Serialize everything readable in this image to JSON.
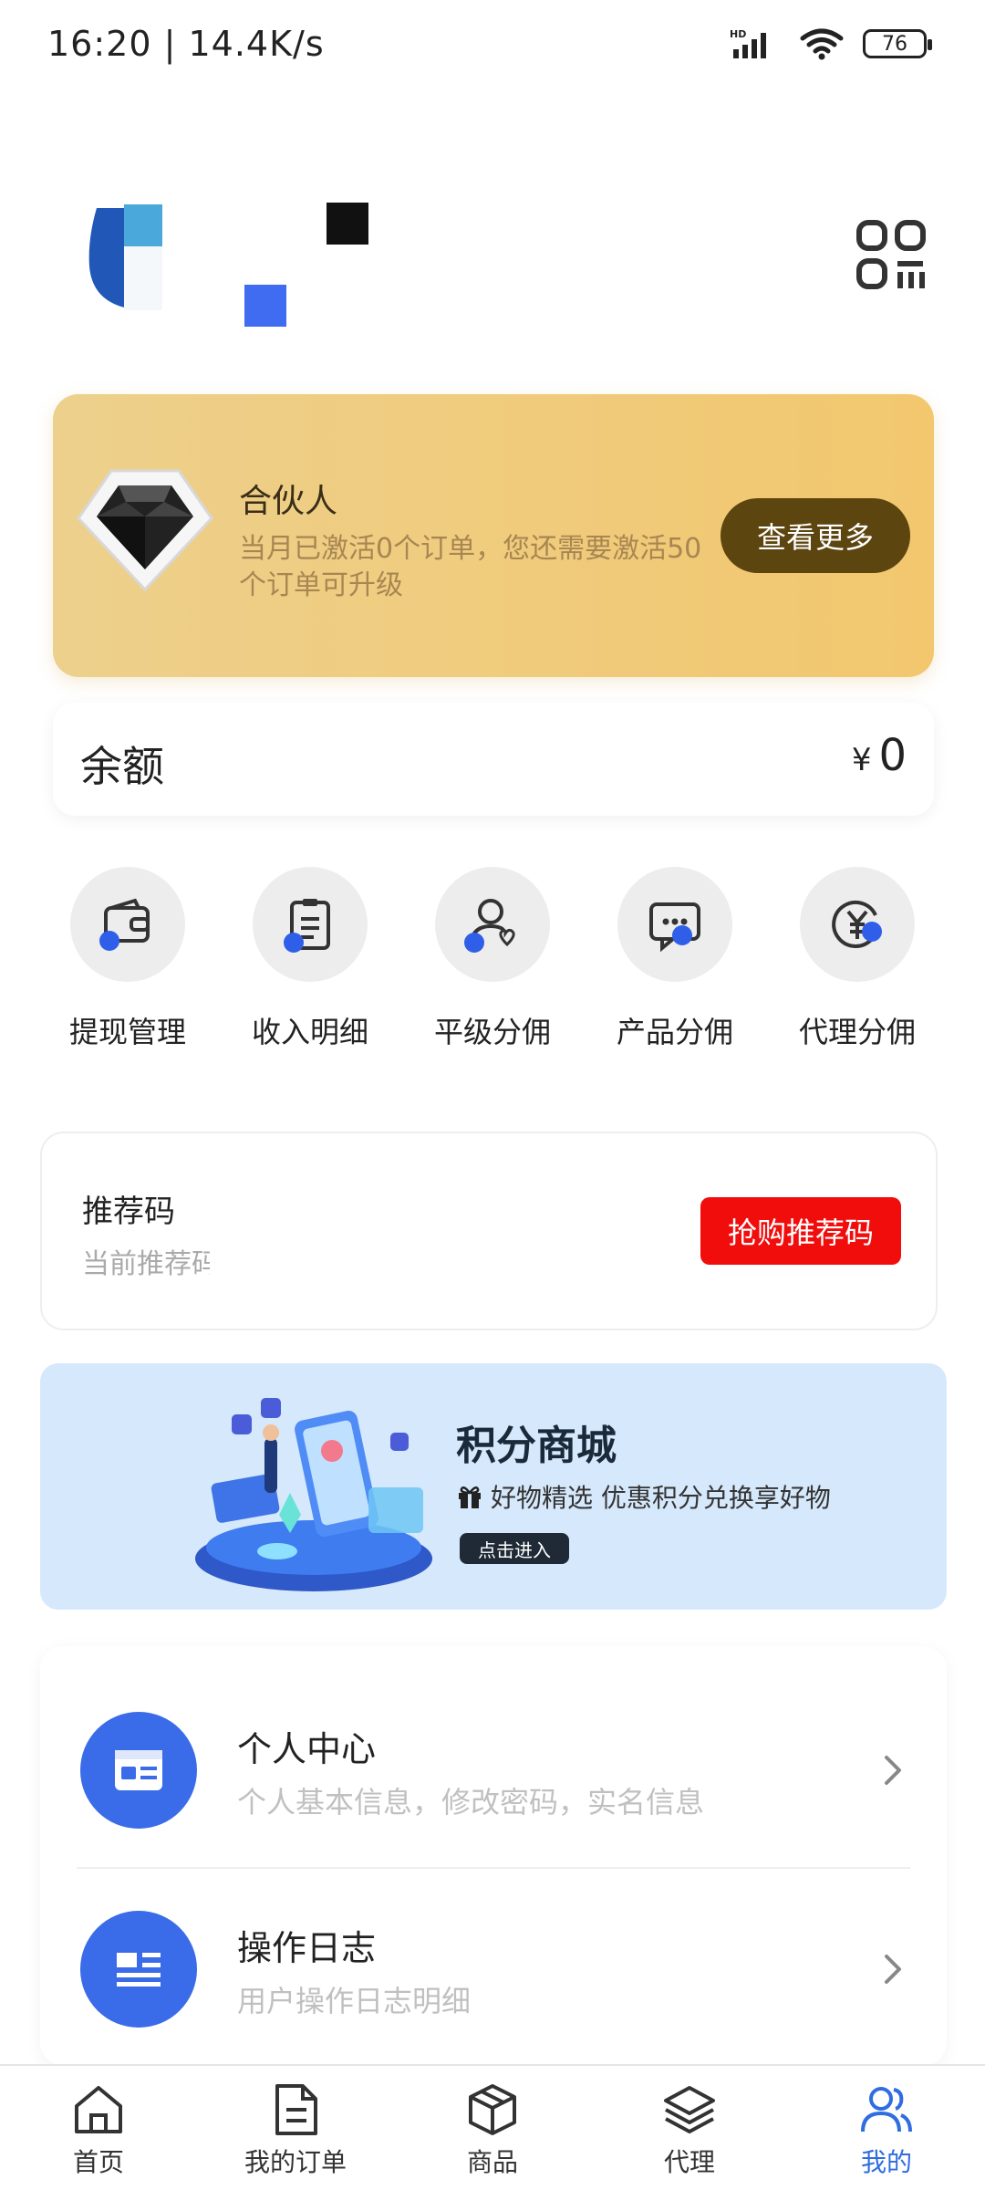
{
  "status_bar": {
    "time": "16:20",
    "speed": "14.4K/s",
    "hd": "HD",
    "battery": "76"
  },
  "partner_card": {
    "title": "合伙人",
    "desc": "当月已激活0个订单，您还需要激活50个订单可升级",
    "more_label": "查看更多"
  },
  "balance": {
    "label": "余额",
    "currency": "¥",
    "value": "0"
  },
  "quick_menu": [
    {
      "label": "提现管理",
      "icon": "wallet-icon"
    },
    {
      "label": "收入明细",
      "icon": "clipboard-icon"
    },
    {
      "label": "平级分佣",
      "icon": "user-heart-icon"
    },
    {
      "label": "产品分佣",
      "icon": "chat-icon"
    },
    {
      "label": "代理分佣",
      "icon": "yen-coin-icon"
    }
  ],
  "referral": {
    "title": "推荐码",
    "subtitle": "当前推荐码",
    "buy_label": "抢购推荐码"
  },
  "points_mall": {
    "title": "积分商城",
    "subtitle": "好物精选 优惠积分兑换享好物",
    "enter_label": "点击进入"
  },
  "menu_items": [
    {
      "title": "个人中心",
      "desc": "个人基本信息，修改密码，实名信息",
      "icon": "id-card-icon"
    },
    {
      "title": "操作日志",
      "desc": "用户操作日志明细",
      "icon": "news-icon"
    }
  ],
  "tabbar": [
    {
      "label": "首页",
      "icon": "home-icon",
      "active": false
    },
    {
      "label": "我的订单",
      "icon": "document-icon",
      "active": false
    },
    {
      "label": "商品",
      "icon": "box-icon",
      "active": false
    },
    {
      "label": "代理",
      "icon": "layers-icon",
      "active": false
    },
    {
      "label": "我的",
      "icon": "users-icon",
      "active": true
    }
  ],
  "colors": {
    "accent_blue": "#3a6be8",
    "active_tab": "#2f6de0",
    "gold_button": "#5d4510",
    "red_button": "#f20d0d",
    "points_bg": "#d6e8fb"
  }
}
